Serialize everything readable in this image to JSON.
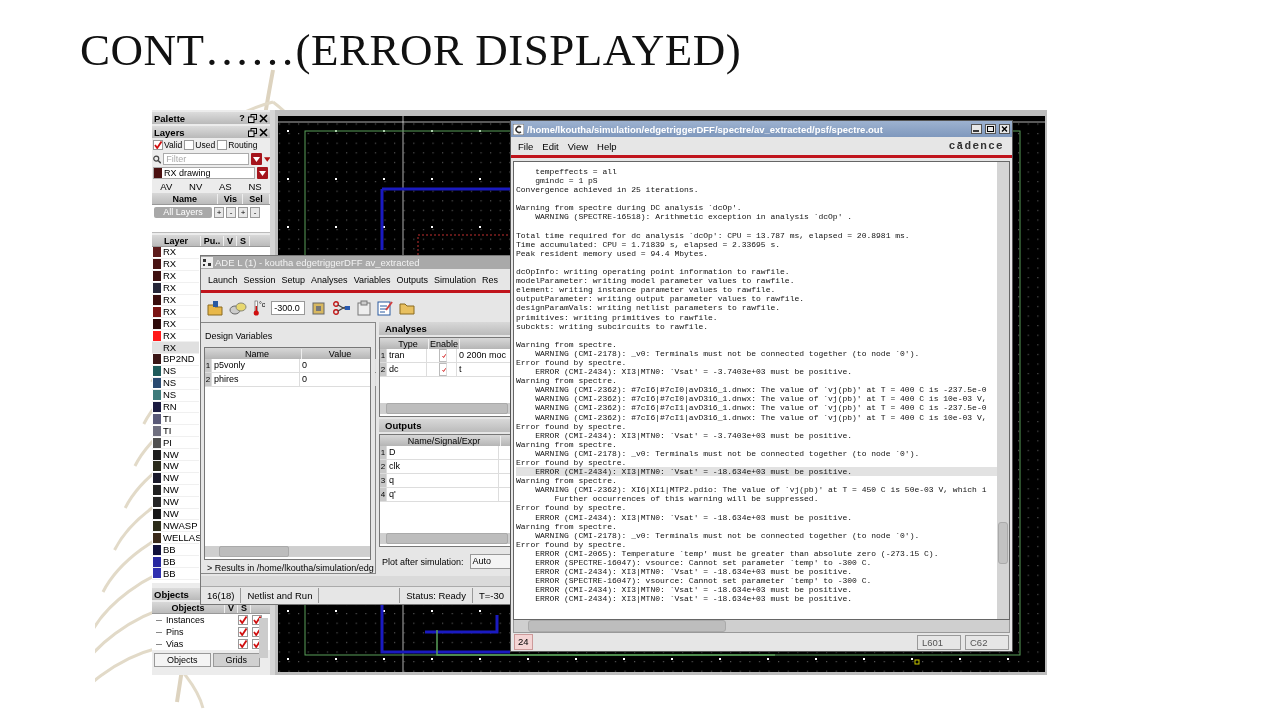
{
  "slide": {
    "title": "CONT……(ERROR DISPLAYED)"
  },
  "palette": {
    "title": "Palette",
    "help_button": "?",
    "layers_title": "Layers",
    "filters": [
      {
        "label": "Valid",
        "checked": true
      },
      {
        "label": "Used",
        "checked": false
      },
      {
        "label": "Routing",
        "checked": false
      }
    ],
    "search": {
      "placeholder": "Filter"
    },
    "layer_select": {
      "value": "RX drawing"
    },
    "tabs": [
      {
        "label": "AV"
      },
      {
        "label": "NV"
      },
      {
        "label": "AS"
      },
      {
        "label": "NS"
      }
    ],
    "set_columns": [
      "Name",
      "Vis",
      "Sel"
    ],
    "set_row": {
      "name": "All Layers",
      "buttons": [
        "+",
        "-",
        "+",
        "-"
      ]
    },
    "layer_columns": [
      "Layer",
      "Pu..",
      "V",
      "S"
    ],
    "layers": [
      {
        "name": "RX",
        "color": "#5c1a1a",
        "selected": false
      },
      {
        "name": "RX",
        "color": "#4a1414",
        "selected": false
      },
      {
        "name": "RX",
        "color": "#3d1010",
        "selected": false
      },
      {
        "name": "RX",
        "color": "#262638",
        "selected": false
      },
      {
        "name": "RX",
        "color": "#3a0d0d",
        "selected": false
      },
      {
        "name": "RX",
        "color": "#7a1414",
        "selected": false
      },
      {
        "name": "RX",
        "color": "#2e0a0a",
        "selected": false
      },
      {
        "name": "RX",
        "color": "#ff1a1a",
        "selected": false
      },
      {
        "name": "RX",
        "selected": true
      },
      {
        "name": "BP2ND",
        "color": "#3a1515",
        "selected": false
      },
      {
        "name": "NS",
        "color": "#1e5a5a",
        "selected": false
      },
      {
        "name": "NS",
        "color": "#2a4a70",
        "selected": false
      },
      {
        "name": "NS",
        "color": "#3d7a7a",
        "selected": false
      },
      {
        "name": "RN",
        "color": "#1a1a40",
        "selected": false
      },
      {
        "name": "TI",
        "color": "#5a5a78",
        "selected": false
      },
      {
        "name": "TI",
        "color": "#707080",
        "selected": false
      },
      {
        "name": "PI",
        "color": "#505050",
        "selected": false
      },
      {
        "name": "NW",
        "color": "#1c1c1c",
        "selected": false
      },
      {
        "name": "NW",
        "color": "#2a2a1c",
        "selected": false
      },
      {
        "name": "NW",
        "color": "#1a1a2a",
        "selected": false
      },
      {
        "name": "NW",
        "color": "#202020",
        "selected": false
      },
      {
        "name": "NW",
        "color": "#252525",
        "selected": false
      },
      {
        "name": "NW",
        "color": "#161616",
        "selected": false
      },
      {
        "name": "NWASP",
        "color": "#2c2c1a",
        "selected": false
      },
      {
        "name": "WELLAS",
        "color": "#3a2a1a",
        "selected": false
      },
      {
        "name": "BB",
        "color": "#10103a",
        "selected": false
      },
      {
        "name": "BB",
        "color": "#2828a0",
        "selected": false
      },
      {
        "name": "BB",
        "color": "#3030b0",
        "selected": false
      }
    ],
    "objects_title": "Objects",
    "object_columns": [
      "Objects",
      "V",
      "S"
    ],
    "objects": [
      {
        "name": "Instances",
        "visible": true,
        "selectable": true
      },
      {
        "name": "Pins",
        "visible": true,
        "selectable": true
      },
      {
        "name": "Vias",
        "visible": true,
        "selectable": true
      }
    ],
    "bottom_tabs": [
      {
        "label": "Objects",
        "selected": true
      },
      {
        "label": "Grids",
        "selected": false
      }
    ]
  },
  "ade": {
    "title": "ADE L (1) - koutha edgetriggerDFF av_extracted",
    "menu": [
      "Launch",
      "Session",
      "Setup",
      "Analyses",
      "Variables",
      "Outputs",
      "Simulation",
      "Res"
    ],
    "temperature": {
      "unit": "°c",
      "value": "-300.0"
    },
    "design_variables": {
      "title": "Design Variables",
      "columns": [
        "Name",
        "Value"
      ],
      "rows": [
        {
          "index": "1",
          "name": "p5vonly",
          "value": "0"
        },
        {
          "index": "2",
          "name": "phires",
          "value": "0"
        }
      ]
    },
    "results": "> Results in /home/lkoutha/simulation/edg",
    "analyses": {
      "title": "Analyses",
      "columns": [
        "Type",
        "Enable"
      ],
      "rows": [
        {
          "index": "1",
          "type": "tran",
          "enabled": true,
          "arguments": "0 200n moc"
        },
        {
          "index": "2",
          "type": "dc",
          "enabled": true,
          "arguments": "t"
        }
      ]
    },
    "outputs": {
      "title": "Outputs",
      "columns": [
        "Name/Signal/Expr"
      ],
      "rows": [
        {
          "index": "1",
          "name": "D"
        },
        {
          "index": "2",
          "name": "clk"
        },
        {
          "index": "3",
          "name": "q"
        },
        {
          "index": "4",
          "name": "q'"
        }
      ]
    },
    "plot_after": {
      "label": "Plot after simulation:",
      "value": "Auto"
    },
    "status": {
      "count": "16(18)",
      "action": "Netlist and Run",
      "state": "Status: Ready",
      "temperature": "T=-30"
    }
  },
  "log": {
    "title": "/home/lkoutha/simulation/edgetriggerDFF/spectre/av_extracted/psf/spectre.out",
    "menu": [
      "File",
      "Edit",
      "View",
      "Help"
    ],
    "logo": "cādence",
    "blocks": [
      [
        {
          "text": "    tempeffects = all",
          "selected": false
        },
        {
          "text": "    gmindc = 1 pS",
          "selected": false
        },
        {
          "text": "Convergence achieved in 25 iterations.",
          "selected": false
        }
      ],
      [
        {
          "text": "Warning from spectre during DC analysis `dcOp'.",
          "selected": false
        },
        {
          "text": "    WARNING (SPECTRE-16518): Arithmetic exception in analysis `dcOp' .",
          "selected": false
        }
      ],
      [
        {
          "text": "Total time required for dc analysis `dcOp': CPU = 13.787 ms, elapsed = 20.8981 ms.",
          "selected": false
        },
        {
          "text": "Time accumulated: CPU = 1.71839 s, elapsed = 2.33695 s.",
          "selected": false
        },
        {
          "text": "Peak resident memory used = 94.4 Mbytes.",
          "selected": false
        }
      ],
      [
        {
          "text": "dcOpInfo: writing operating point information to rawfile.",
          "selected": false
        },
        {
          "text": "modelParameter: writing model parameter values to rawfile.",
          "selected": false
        },
        {
          "text": "element: writing instance parameter values to rawfile.",
          "selected": false
        },
        {
          "text": "outputParameter: writing output parameter values to rawfile.",
          "selected": false
        },
        {
          "text": "designParamVals: writing netlist parameters to rawfile.",
          "selected": false
        },
        {
          "text": "primitives: writing primitives to rawfile.",
          "selected": false
        },
        {
          "text": "subckts: writing subcircuits to rawfile.",
          "selected": false
        }
      ],
      [
        {
          "text": "Warning from spectre.",
          "selected": false
        },
        {
          "text": "    WARNING (CMI-2178): _v0: Terminals must not be connected together (to node `0').",
          "selected": false
        },
        {
          "text": "Error found by spectre.",
          "selected": false
        },
        {
          "text": "    ERROR (CMI-2434): XI3|MTN0: `Vsat' = -3.7403e+03 must be positive.",
          "selected": false
        },
        {
          "text": "Warning from spectre.",
          "selected": false
        },
        {
          "text": "    WARNING (CMI-2362): #7cI6|#7cI0|avD316_1.dnwx: The value of `vj(pb)' at T = 400 C is -237.5e-0",
          "selected": false
        },
        {
          "text": "    WARNING (CMI-2362): #7cI6|#7cI0|avD316_1.dnwx: The value of `vj(pb)' at T = 400 C is 10e-03 V,",
          "selected": false
        },
        {
          "text": "    WARNING (CMI-2362): #7cI6|#7cI1|avD316_1.dnwx: The value of `vj(pb)' at T = 400 C is -237.5e-0",
          "selected": false
        },
        {
          "text": "    WARNING (CMI-2362): #7cI6|#7cI1|avD316_1.dnwx: The value of `vj(pb)' at T = 400 C is 10e-03 V,",
          "selected": false
        },
        {
          "text": "Error found by spectre.",
          "selected": false
        },
        {
          "text": "    ERROR (CMI-2434): XI3|MTN0: `Vsat' = -3.7403e+03 must be positive.",
          "selected": false
        },
        {
          "text": "Warning from spectre.",
          "selected": false
        },
        {
          "text": "    WARNING (CMI-2178): _v0: Terminals must not be connected together (to node `0').",
          "selected": false
        },
        {
          "text": "Error found by spectre.",
          "selected": false
        },
        {
          "text": "    ERROR (CMI-2434): XI3|MTN0: `Vsat' = -18.634e+03 must be positive.",
          "selected": true
        },
        {
          "text": "Warning from spectre.",
          "selected": false
        },
        {
          "text": "    WARNING (CMI-2362): XI6|XI1|MTP2.pdio: The value of `vj(pb)' at T = 450 C is 50e-03 V, which i",
          "selected": false
        },
        {
          "text": "        Further occurrences of this warning will be suppressed.",
          "selected": false
        },
        {
          "text": "Error found by spectre.",
          "selected": false
        },
        {
          "text": "    ERROR (CMI-2434): XI3|MTN0: `Vsat' = -18.634e+03 must be positive.",
          "selected": false
        },
        {
          "text": "Warning from spectre.",
          "selected": false
        },
        {
          "text": "    WARNING (CMI-2178): _v0: Terminals must not be connected together (to node `0').",
          "selected": false
        },
        {
          "text": "Error found by spectre.",
          "selected": false
        },
        {
          "text": "    ERROR (CMI-2065): Temperature `temp' must be greater than absolute zero (-273.15 C).",
          "selected": false
        },
        {
          "text": "    ERROR (SPECTRE-16047): vsource: Cannot set parameter `temp' to -300 C.",
          "selected": false
        },
        {
          "text": "    ERROR (CMI-2434): XI3|MTN0: `Vsat' = -18.634e+03 must be positive.",
          "selected": false
        },
        {
          "text": "    ERROR (SPECTRE-16047): vsource: Cannot set parameter `temp' to -300 C.",
          "selected": false
        },
        {
          "text": "    ERROR (CMI-2434): XI3|MTN0: `Vsat' = -18.634e+03 must be positive.",
          "selected": false
        },
        {
          "text": "    ERROR (CMI-2434): XI3|MTN0: `Vsat' = -18.634e+03 must be positive.",
          "selected": false
        }
      ]
    ],
    "status": {
      "line_count": "24",
      "line": "L601",
      "column": "C62"
    }
  }
}
